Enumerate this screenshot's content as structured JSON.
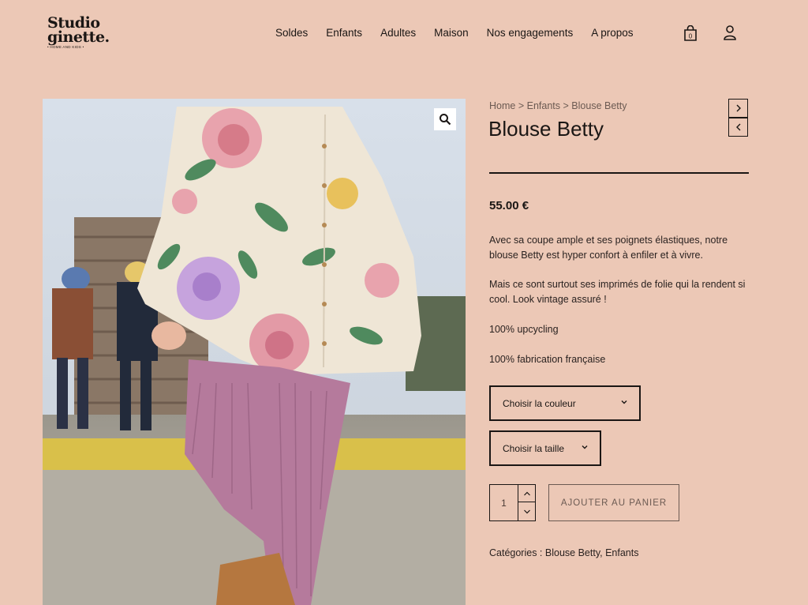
{
  "brand": {
    "line1": "Studio",
    "line2": "ginette.",
    "tagline": "• HOME AND KIDS •"
  },
  "nav": {
    "items": [
      {
        "label": "Soldes"
      },
      {
        "label": "Enfants"
      },
      {
        "label": "Adultes"
      },
      {
        "label": "Maison"
      },
      {
        "label": "Nos engagements"
      },
      {
        "label": "A propos"
      }
    ],
    "cart_count": "0"
  },
  "breadcrumb": {
    "home": "Home",
    "sep": ">",
    "category": "Enfants",
    "current": "Blouse Betty"
  },
  "product": {
    "title": "Blouse Betty",
    "price": "55.00 €",
    "description": [
      "Avec sa coupe ample et ses poignets élastiques, notre blouse Betty est hyper confort à enfiler et à vivre.",
      "Mais ce sont surtout ses imprimés de folie qui la rendent si cool.  Look vintage assuré !",
      "100% upcycling",
      "100% fabrication française"
    ],
    "color_select": "Choisir la couleur",
    "size_select": "Choisir la taille",
    "quantity": "1",
    "add_to_cart": "AJOUTER AU PANIER",
    "categories_label": "Catégories :",
    "categories": "Blouse Betty, Enfants"
  },
  "icons": {
    "cart": "shopping-bag-icon",
    "user": "user-icon",
    "zoom": "magnifier-icon",
    "next": "chevron-right-icon",
    "prev": "chevron-left-icon"
  },
  "colors": {
    "background": "#ecc8b6",
    "text": "#1a1614"
  }
}
